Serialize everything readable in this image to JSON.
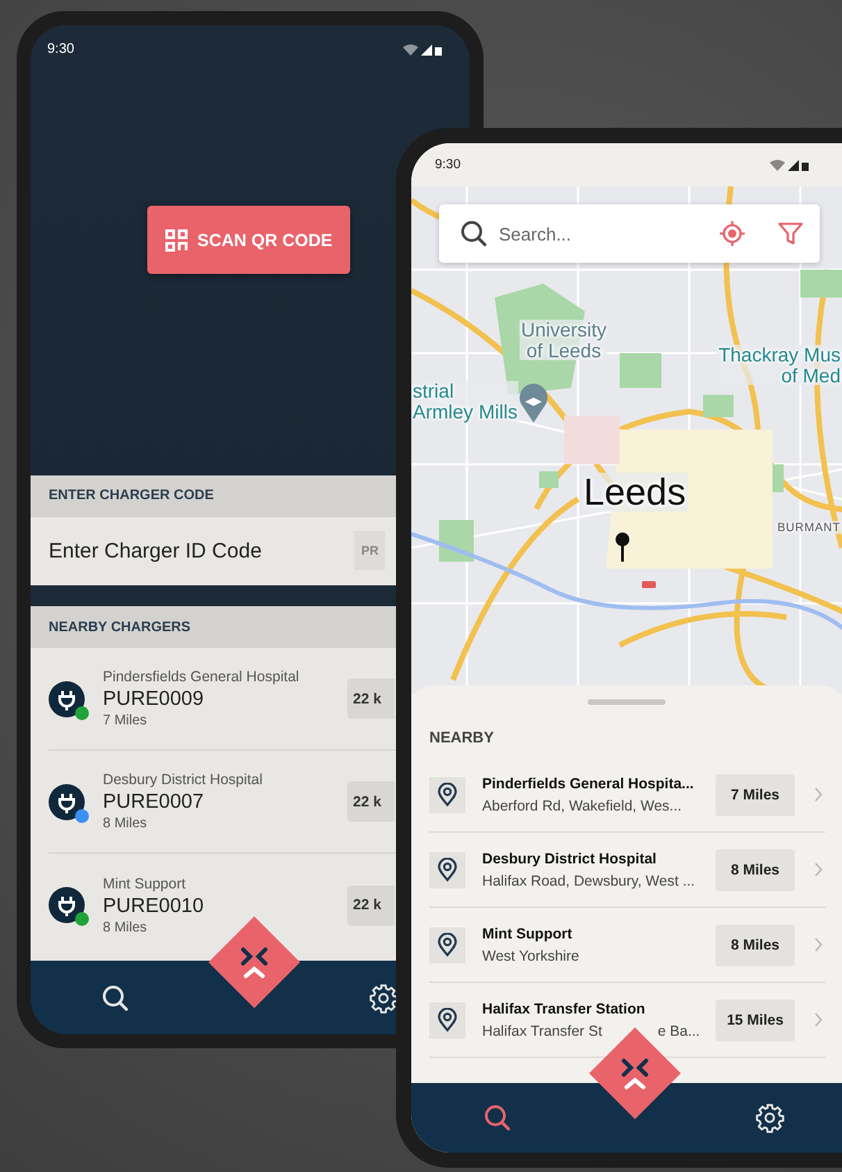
{
  "left_screen": {
    "status_bar": {
      "time": "9:30"
    },
    "scan_button": {
      "label": "SCAN QR CODE"
    },
    "charger_code": {
      "heading": "ENTER CHARGER CODE",
      "placeholder": "Enter Charger ID Code",
      "button": "PR"
    },
    "nearby": {
      "heading": "NEARBY CHARGERS",
      "items": [
        {
          "site": "Pindersfields General Hospital",
          "code": "PURE0009",
          "distance": "7 Miles",
          "power": "22 k",
          "color": "#1fa33a"
        },
        {
          "site": "Desbury District Hospital",
          "code": "PURE0007",
          "distance": "8 Miles",
          "power": "22 k",
          "color": "#3b8ff0"
        },
        {
          "site": "Mint Support",
          "code": "PURE0010",
          "distance": "8 Miles",
          "power": "22 k",
          "color": "#1fa33a"
        }
      ]
    },
    "bottom_nav": {
      "items": [
        {
          "kind": "search",
          "selected": false
        },
        {
          "kind": "settings",
          "selected": false
        }
      ]
    }
  },
  "right_screen": {
    "status_bar": {
      "time": "9:30"
    },
    "search": {
      "placeholder": "Search..."
    },
    "map_labels": [
      {
        "kind": "place",
        "text": "University\nof Leeds"
      },
      {
        "kind": "museum",
        "text": "Thackray Mus\nof Med"
      },
      {
        "kind": "museum-left",
        "text": "strial\nArmley Mills"
      },
      {
        "kind": "city",
        "text": "Leeds"
      },
      {
        "kind": "district",
        "text": "BURMANT"
      }
    ],
    "nearby": {
      "heading": "NEARBY",
      "items": [
        {
          "name": "Pinderfields General Hospita...",
          "address": [
            "Aberford Rd, Wakefield, Wes..."
          ],
          "distance": "7 Miles"
        },
        {
          "name": "Desbury District Hospital",
          "address": [
            "Halifax Road, Dewsbury, West ..."
          ],
          "distance": "8 Miles"
        },
        {
          "name": "Mint Support",
          "address": [
            "West Yorkshire"
          ],
          "distance": "8 Miles"
        },
        {
          "name": "Halifax Transfer Station",
          "address": [
            "Halifax Transfer St",
            "e Ba..."
          ],
          "distance": "15 Miles"
        }
      ]
    },
    "bottom_nav": {
      "items": [
        {
          "kind": "search",
          "selected": true
        },
        {
          "kind": "settings",
          "selected": false
        }
      ]
    }
  }
}
